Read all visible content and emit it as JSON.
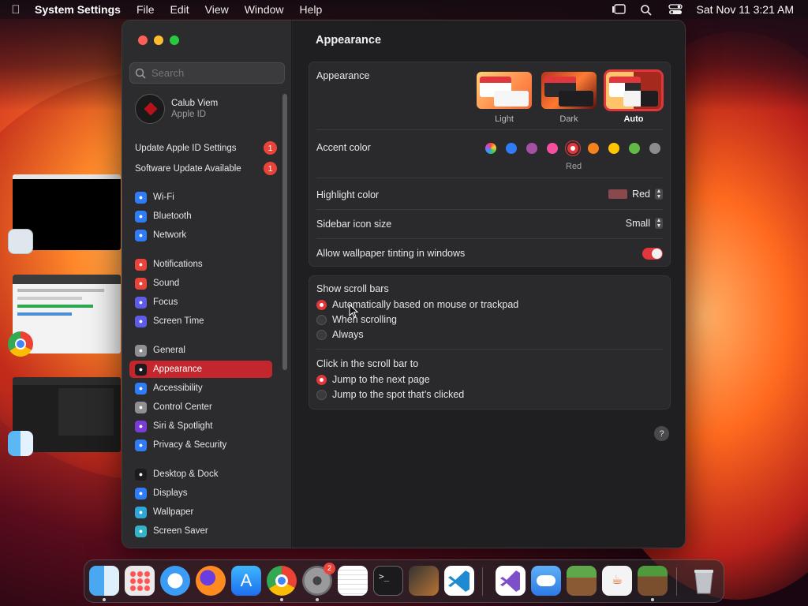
{
  "menubar": {
    "app": "System Settings",
    "items": [
      "File",
      "Edit",
      "View",
      "Window",
      "Help"
    ],
    "clock": "Sat Nov 11  3:21 AM"
  },
  "sidebar": {
    "search_placeholder": "Search",
    "account": {
      "name": "Calub Viem",
      "subtitle": "Apple ID"
    },
    "notices": [
      {
        "label": "Update Apple ID Settings",
        "count": "1"
      },
      {
        "label": "Software Update Available",
        "count": "1"
      }
    ],
    "items": [
      {
        "label": "Wi-Fi",
        "icon": "wifi-icon",
        "color": "#2f7cf6"
      },
      {
        "label": "Bluetooth",
        "icon": "bluetooth-icon",
        "color": "#2f7cf6"
      },
      {
        "label": "Network",
        "icon": "globe-icon",
        "color": "#2f7cf6"
      },
      {
        "label": "Notifications",
        "icon": "bell-icon",
        "color": "#e8443a"
      },
      {
        "label": "Sound",
        "icon": "speaker-icon",
        "color": "#e8443a"
      },
      {
        "label": "Focus",
        "icon": "moon-icon",
        "color": "#5e5ce6"
      },
      {
        "label": "Screen Time",
        "icon": "hourglass-icon",
        "color": "#5e5ce6"
      },
      {
        "label": "General",
        "icon": "gear-icon",
        "color": "#8e8e93"
      },
      {
        "label": "Appearance",
        "icon": "appearance-icon",
        "color": "#1c1c1e"
      },
      {
        "label": "Accessibility",
        "icon": "accessibility-icon",
        "color": "#2f7cf6"
      },
      {
        "label": "Control Center",
        "icon": "control-center-icon",
        "color": "#8e8e93"
      },
      {
        "label": "Siri & Spotlight",
        "icon": "siri-icon",
        "color": "#7a3cd6"
      },
      {
        "label": "Privacy & Security",
        "icon": "hand-icon",
        "color": "#2f7cf6"
      },
      {
        "label": "Desktop & Dock",
        "icon": "dock-icon",
        "color": "#1c1c1e"
      },
      {
        "label": "Displays",
        "icon": "display-icon",
        "color": "#2f7cf6"
      },
      {
        "label": "Wallpaper",
        "icon": "wallpaper-icon",
        "color": "#2fa7d6"
      },
      {
        "label": "Screen Saver",
        "icon": "screensaver-icon",
        "color": "#35b2c8"
      }
    ],
    "selected_index": 8
  },
  "content": {
    "title": "Appearance",
    "appearance": {
      "label": "Appearance",
      "modes": [
        "Light",
        "Dark",
        "Auto"
      ],
      "selected": "Auto"
    },
    "accent": {
      "label": "Accent color",
      "colors": [
        "#a06de0",
        "#2f7cf6",
        "#a550a7",
        "#f74f9e",
        "#e0363c",
        "#f7821b",
        "#ffc600",
        "#62ba46",
        "#8c8c8c"
      ],
      "selected_name": "Red"
    },
    "highlight": {
      "label": "Highlight color",
      "value": "Red",
      "swatch": "#8a4a4d"
    },
    "icon_size": {
      "label": "Sidebar icon size",
      "value": "Small"
    },
    "tinting": {
      "label": "Allow wallpaper tinting in windows",
      "on": true
    },
    "scroll_bars": {
      "label": "Show scroll bars",
      "options": [
        "Automatically based on mouse or trackpad",
        "When scrolling",
        "Always"
      ],
      "selected": 0
    },
    "click_scroll": {
      "label": "Click in the scroll bar to",
      "options": [
        "Jump to the next page",
        "Jump to the spot that’s clicked"
      ],
      "selected": 0
    },
    "help": "?"
  },
  "dock": {
    "badge_settings": "2",
    "apps": [
      "Finder",
      "Launchpad",
      "Safari",
      "Firefox",
      "App Store",
      "Chrome",
      "System Settings",
      "TextEdit",
      "Terminal",
      "Instruments",
      "VS Code",
      "Visual Studio",
      "iCloud",
      "Minecraft Launcher",
      "Java",
      "Minecraft",
      "Trash"
    ]
  }
}
